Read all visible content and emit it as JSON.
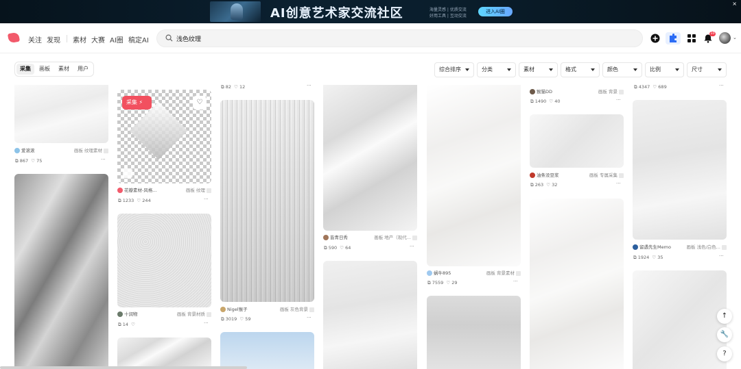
{
  "banner": {
    "title": "AI创意艺术家交流社区",
    "sub1": "海量灵感 | 优质交流",
    "sub2": "好用工具 | 互动交流",
    "button": "进入AI圈",
    "close": "×"
  },
  "nav": {
    "follow": "关注",
    "discover": "发现",
    "material": "素材",
    "contest": "大赛",
    "ai_circle": "AI圈",
    "gaoding_ai": "稿定AI"
  },
  "search": {
    "value": "浅色纹理"
  },
  "notifications": {
    "count": "10"
  },
  "tabs": [
    "采集",
    "画板",
    "素材",
    "用户"
  ],
  "filters": [
    "综合排序",
    "分类",
    "素材",
    "格式",
    "颜色",
    "比例",
    "尺寸"
  ],
  "cards": {
    "c1": {
      "author": "爱滚滚",
      "board_prefix": "画板",
      "board": "纹理素材",
      "saves": "867",
      "likes": "75"
    },
    "c2": {
      "collect": "采集",
      "author": "花瓣素材-风格...",
      "board_prefix": "画板",
      "board": "纹理",
      "saves": "1233",
      "likes": "244"
    },
    "c3": {
      "author": "十润物",
      "board_prefix": "画板",
      "board": "背景材质",
      "saves": "14",
      "likes": ""
    },
    "c4_top": {
      "saves": "82",
      "likes": "12"
    },
    "c4": {
      "author": "Nigel猴子",
      "board_prefix": "画板",
      "board": "灰色背景",
      "saves": "3019",
      "likes": "59"
    },
    "c5": {
      "author": "皆青日秀",
      "board_prefix": "画板",
      "board": "地产（现代...",
      "saves": "590",
      "likes": "64"
    },
    "c6": {
      "author": "蜗牛895",
      "board_prefix": "画板",
      "board": "背景素材",
      "saves": "7559",
      "likes": "29"
    },
    "c7_top": {
      "author": "猴猫DD",
      "board_prefix": "画板",
      "board": "背景",
      "saves": "1490",
      "likes": "40"
    },
    "c7": {
      "author": "油条没豆浆",
      "board_prefix": "画板",
      "board": "专属采集",
      "saves": "263",
      "likes": "32"
    },
    "c8_top": {
      "saves": "4347",
      "likes": "689"
    },
    "c8": {
      "author": "留遇先生Memo",
      "board_prefix": "画板",
      "board": "浅色/白色...",
      "saves": "1924",
      "likes": "35"
    }
  },
  "float_buttons": {
    "top": "↑",
    "tool": "🔧",
    "help": "?"
  }
}
